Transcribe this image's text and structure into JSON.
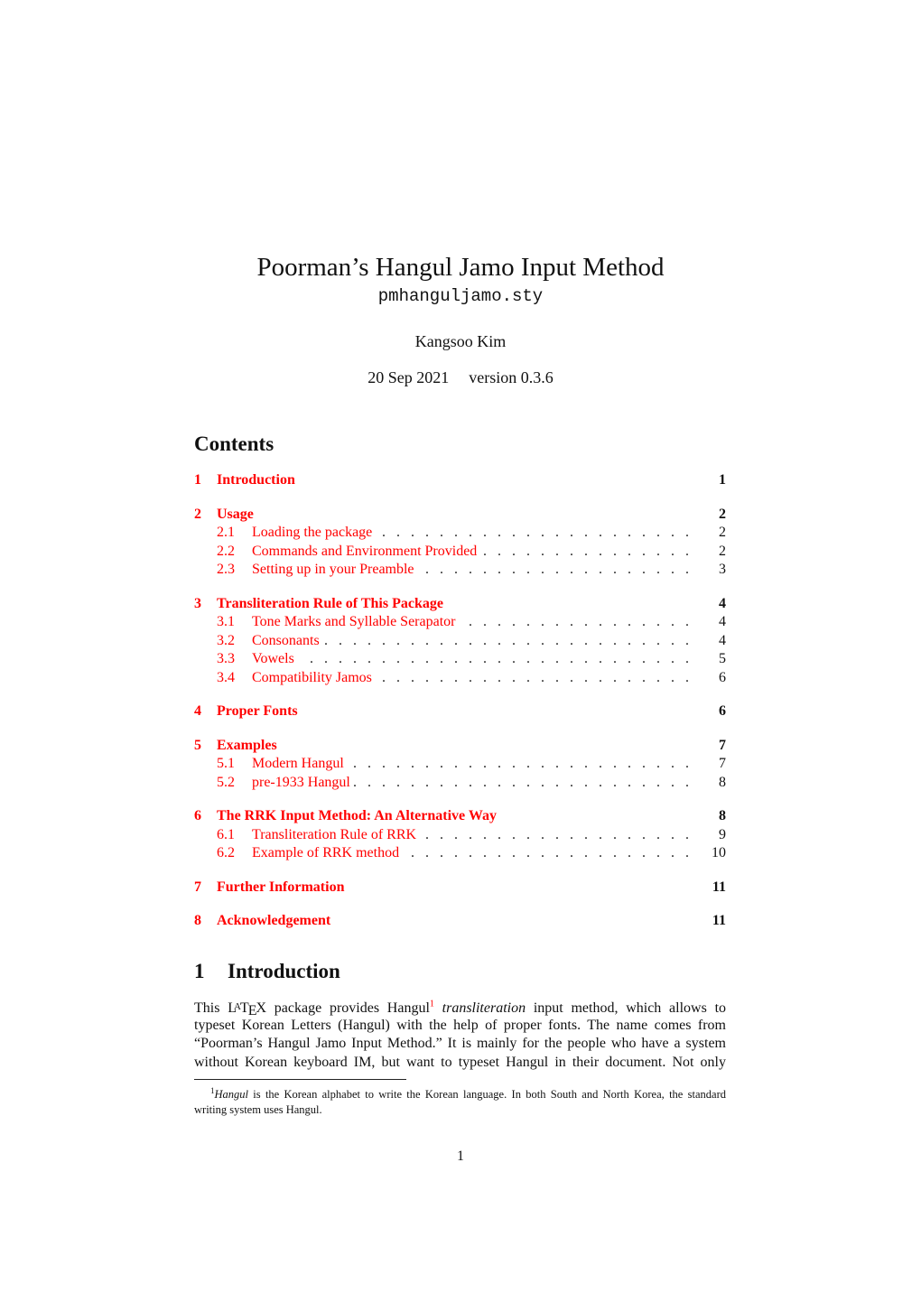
{
  "header": {
    "title": "Poorman’s Hangul Jamo Input Method",
    "package": "pmhanguljamo.sty",
    "author": "Kangsoo Kim",
    "date": "20 Sep 2021",
    "version": "version 0.3.6"
  },
  "contents": {
    "heading": "Contents",
    "entries": [
      {
        "num": "1",
        "label": "Introduction",
        "page": "1",
        "level": 1
      },
      {
        "num": "2",
        "label": "Usage",
        "page": "2",
        "level": 1
      },
      {
        "num": "2.1",
        "label": "Loading the package",
        "page": "2",
        "level": 2
      },
      {
        "num": "2.2",
        "label": "Commands and Environment Provided",
        "page": "2",
        "level": 2
      },
      {
        "num": "2.3",
        "label": "Setting up in your Preamble",
        "page": "3",
        "level": 2
      },
      {
        "num": "3",
        "label": "Transliteration Rule of This Package",
        "page": "4",
        "level": 1
      },
      {
        "num": "3.1",
        "label": "Tone Marks and Syllable Serapator",
        "page": "4",
        "level": 2
      },
      {
        "num": "3.2",
        "label": "Consonants",
        "page": "4",
        "level": 2
      },
      {
        "num": "3.3",
        "label": "Vowels",
        "page": "5",
        "level": 2
      },
      {
        "num": "3.4",
        "label": "Compatibility Jamos",
        "page": "6",
        "level": 2
      },
      {
        "num": "4",
        "label": "Proper Fonts",
        "page": "6",
        "level": 1
      },
      {
        "num": "5",
        "label": "Examples",
        "page": "7",
        "level": 1
      },
      {
        "num": "5.1",
        "label": "Modern Hangul",
        "page": "7",
        "level": 2
      },
      {
        "num": "5.2",
        "label": "pre-1933 Hangul",
        "page": "8",
        "level": 2
      },
      {
        "num": "6",
        "label": "The RRK Input Method: An Alternative Way",
        "page": "8",
        "level": 1
      },
      {
        "num": "6.1",
        "label": "Transliteration Rule of RRK",
        "page": "9",
        "level": 2
      },
      {
        "num": "6.2",
        "label": "Example of RRK method",
        "page": "10",
        "level": 2
      },
      {
        "num": "7",
        "label": "Further Information",
        "page": "11",
        "level": 1
      },
      {
        "num": "8",
        "label": "Acknowledgement",
        "page": "11",
        "level": 1
      }
    ]
  },
  "section1": {
    "number": "1",
    "title": "Introduction",
    "lines": [
      {
        "before": "This ",
        "latex": "LaTeX",
        "after_latex": " package provides Hangul",
        "fnref": "1",
        "italic": "transliteration",
        "rest": " input method, which allows to"
      },
      "typeset Korean Letters (Hangul) with the help of proper fonts. The name comes from",
      "“Poorman’s Hangul Jamo Input Method.” It is mainly for the people who have a system",
      "without Korean keyboard IM, but want to typeset Hangul in their document. Not only"
    ]
  },
  "footnote": {
    "mark": "1",
    "italic": "Hangul",
    "text1": " is the Korean alphabet to write the Korean language. In both South and North Korea, the standard",
    "text2": "writing system uses Hangul."
  },
  "page_number": "1",
  "colors": {
    "link": "#ff0000",
    "text": "#111111"
  }
}
